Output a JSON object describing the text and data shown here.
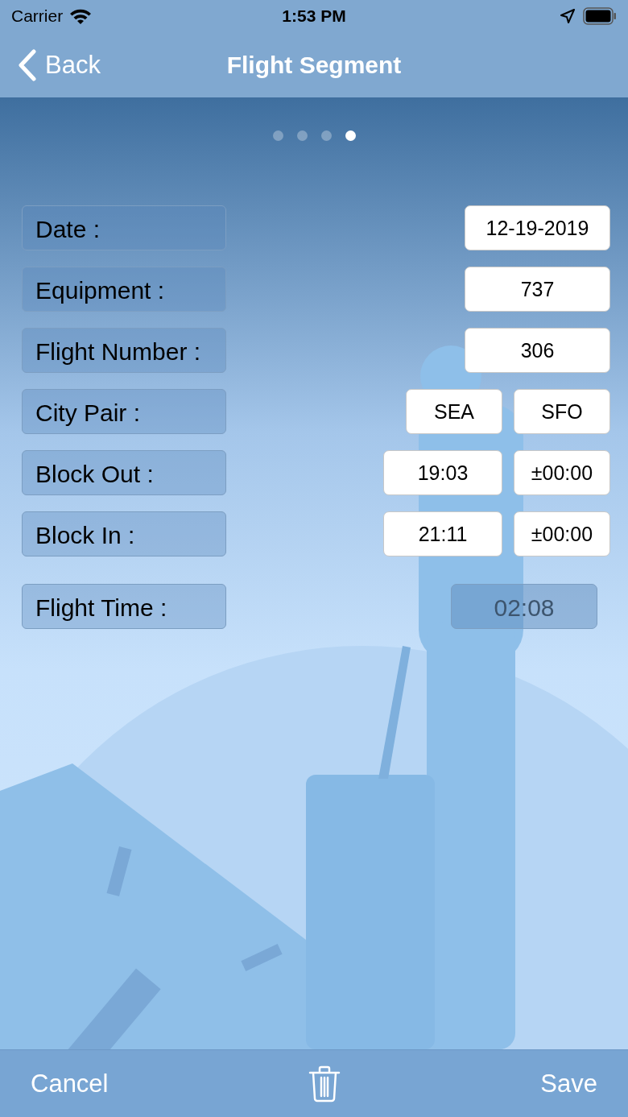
{
  "status_bar": {
    "carrier": "Carrier",
    "time": "1:53 PM"
  },
  "nav_bar": {
    "back": "Back",
    "title": "Flight Segment"
  },
  "page_dots": [
    {
      "selected": false
    },
    {
      "selected": false
    },
    {
      "selected": false
    },
    {
      "selected": true
    }
  ],
  "fields": [
    {
      "label": "Date :",
      "kind": "single",
      "inputs": [
        {
          "value": "12-19-2019",
          "disabled": false
        }
      ]
    },
    {
      "label": "Equipment :",
      "kind": "single",
      "inputs": [
        {
          "value": "737",
          "disabled": false
        }
      ]
    },
    {
      "label": "Flight Number :",
      "kind": "single",
      "inputs": [
        {
          "value": "306",
          "disabled": false
        }
      ]
    },
    {
      "label": "City Pair :",
      "kind": "pair",
      "inputs": [
        {
          "value": "SEA",
          "disabled": false
        },
        {
          "value": "SFO",
          "disabled": false
        }
      ]
    },
    {
      "label": "Block Out :",
      "kind": "time",
      "inputs": [
        {
          "value": "19:03",
          "disabled": false
        },
        {
          "value": "±00:00",
          "disabled": false
        }
      ]
    },
    {
      "label": "Block In :",
      "kind": "time",
      "inputs": [
        {
          "value": "21:11",
          "disabled": false
        },
        {
          "value": "±00:00",
          "disabled": false
        }
      ]
    },
    {
      "label": "Flight Time :",
      "kind": "computed",
      "inputs": [
        {
          "value": "02:08",
          "disabled": true
        }
      ]
    }
  ],
  "toolbar": {
    "cancel": "Cancel",
    "save": "Save"
  }
}
